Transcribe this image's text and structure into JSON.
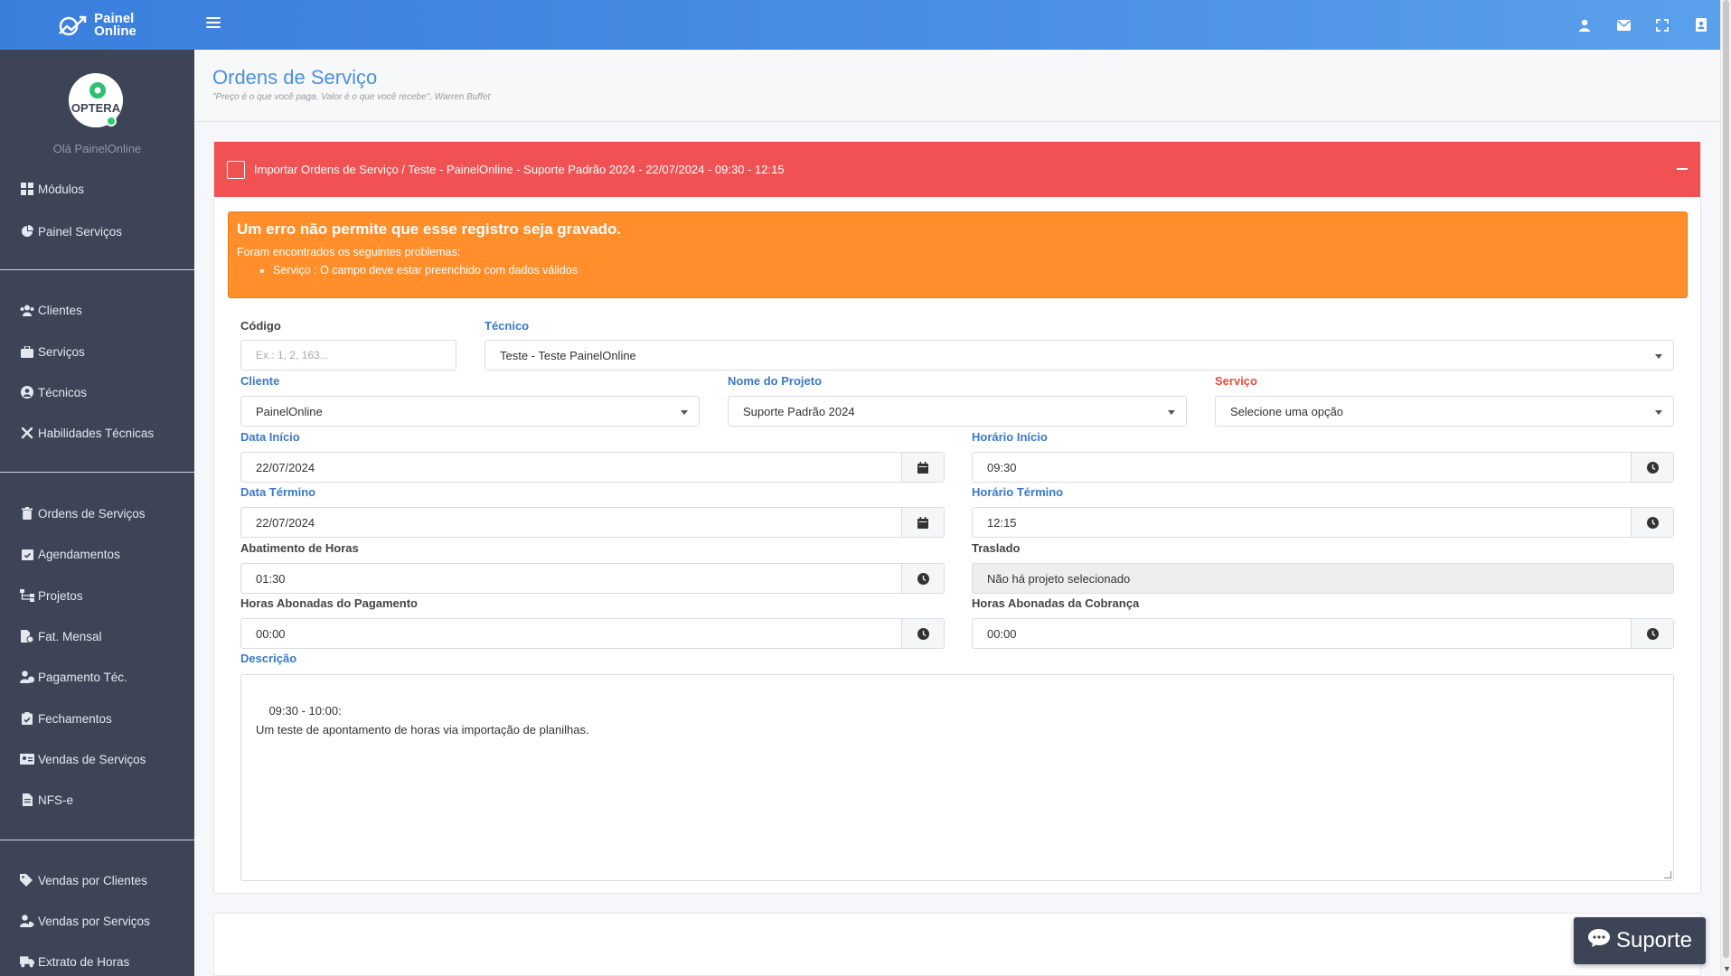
{
  "brand": {
    "line1": "Painel",
    "line2": "Online"
  },
  "user": {
    "greeting": "Olá PainelOnline",
    "avatar_text": "OPTERA"
  },
  "sidebar": {
    "items": [
      {
        "label": "Módulos",
        "icon": "grid-icon"
      },
      {
        "label": "Painel Serviços",
        "icon": "pie-chart-icon"
      },
      {
        "label": "Clientes",
        "icon": "users-icon"
      },
      {
        "label": "Serviços",
        "icon": "briefcase-icon"
      },
      {
        "label": "Técnicos",
        "icon": "user-circle-icon"
      },
      {
        "label": "Habilidades Técnicas",
        "icon": "tools-icon"
      },
      {
        "label": "Ordens de Serviços",
        "icon": "trash-icon"
      },
      {
        "label": "Agendamentos",
        "icon": "calendar-check-icon"
      },
      {
        "label": "Projetos",
        "icon": "sitemap-icon"
      },
      {
        "label": "Fat. Mensal",
        "icon": "file-invoice-icon"
      },
      {
        "label": "Pagamento Téc.",
        "icon": "user-dollar-icon"
      },
      {
        "label": "Fechamentos",
        "icon": "clipboard-check-icon"
      },
      {
        "label": "Vendas de Serviços",
        "icon": "id-card-icon"
      },
      {
        "label": "NFS-e",
        "icon": "file-text-icon"
      },
      {
        "label": "Vendas por Clientes",
        "icon": "tags-icon"
      },
      {
        "label": "Vendas por Serviços",
        "icon": "user-tag-icon"
      },
      {
        "label": "Extrato de Horas",
        "icon": "truck-icon"
      }
    ]
  },
  "header": {
    "title": "Ordens de Serviço",
    "quote": "\"Preço é o que você paga. Valor é o que você recebe\", Warren Buffet"
  },
  "card": {
    "title": "Importar Ordens de Serviço / Teste - PainelOnline - Suporte Padrão 2024 - 22/07/2024 - 09:30 - 12:15",
    "header_color": "#f05253"
  },
  "alert": {
    "title": "Um erro não permite que esse registro seja gravado.",
    "intro": "Foram encontrados os seguintes problemas:",
    "problems": [
      "Serviço : O campo deve estar preenchido com dados válidos"
    ]
  },
  "form": {
    "codigo": {
      "label": "Código",
      "placeholder": "Ex.: 1, 2, 163..."
    },
    "tecnico": {
      "label": "Técnico",
      "value": "Teste - Teste PainelOnline"
    },
    "cliente": {
      "label": "Cliente",
      "value": "PainelOnline"
    },
    "projeto": {
      "label": "Nome do Projeto",
      "value": "Suporte Padrão 2024"
    },
    "servico": {
      "label": "Serviço",
      "value": "Selecione uma opção"
    },
    "data_inicio": {
      "label": "Data Início",
      "value": "22/07/2024"
    },
    "horario_inicio": {
      "label": "Horário Início",
      "value": "09:30"
    },
    "data_termino": {
      "label": "Data Término",
      "value": "22/07/2024"
    },
    "horario_termino": {
      "label": "Horário Término",
      "value": "12:15"
    },
    "abatimento": {
      "label": "Abatimento de Horas",
      "value": "01:30"
    },
    "traslado": {
      "label": "Traslado",
      "value": "Não há projeto selecionado"
    },
    "horas_pagamento": {
      "label": "Horas Abonadas do Pagamento",
      "value": "00:00"
    },
    "horas_cobranca": {
      "label": "Horas Abonadas da Cobrança",
      "value": "00:00"
    },
    "descricao": {
      "label": "Descrição",
      "value": "09:30 - 10:00:\nUm teste de apontamento de horas via importação de planilhas."
    }
  },
  "support_button": {
    "label": "Suporte"
  },
  "colors": {
    "accent": "#4a90e2",
    "sidebar": "#3d4456",
    "alert": "#ff8e2b",
    "error": "#e74c3c"
  }
}
